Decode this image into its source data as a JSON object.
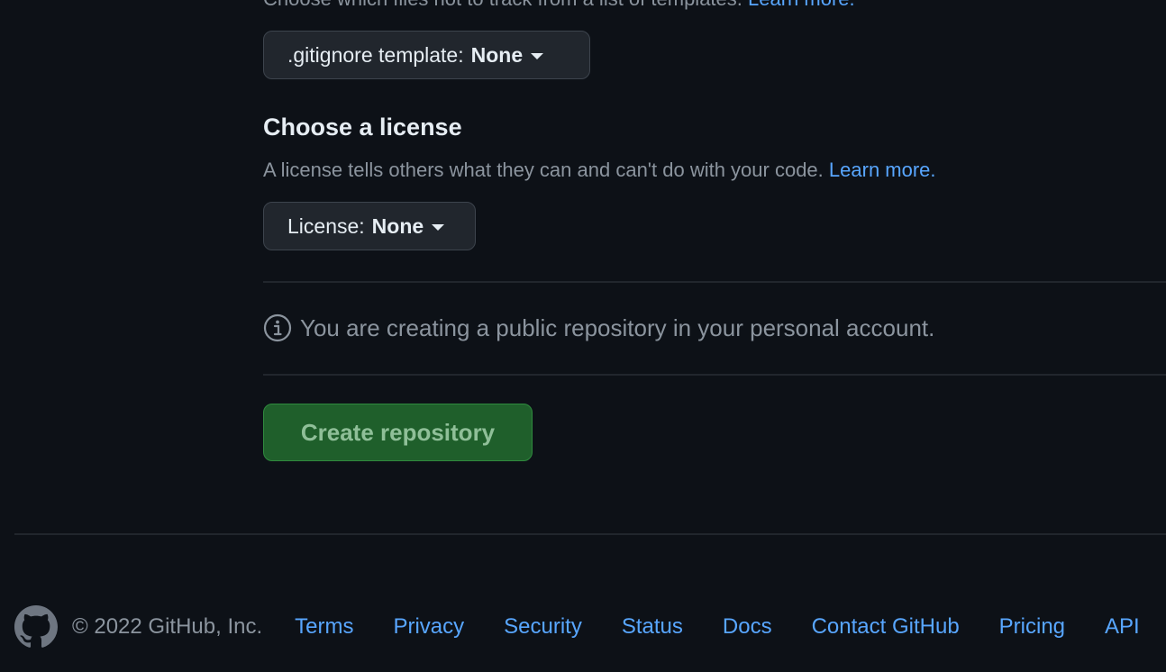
{
  "gitignore_section": {
    "description": "Choose which files not to track from a list of templates.",
    "learn_more": "Learn more.",
    "select_label": ".gitignore template:",
    "select_value": "None"
  },
  "license_section": {
    "heading": "Choose a license",
    "description": "A license tells others what they can and can't do with your code.",
    "learn_more": "Learn more.",
    "select_label": "License:",
    "select_value": "None"
  },
  "notice": {
    "text": "You are creating a public repository in your personal account."
  },
  "create_button": {
    "label": "Create repository"
  },
  "footer": {
    "copyright": "© 2022 GitHub, Inc.",
    "links": [
      "Terms",
      "Privacy",
      "Security",
      "Status",
      "Docs",
      "Contact GitHub",
      "Pricing",
      "API"
    ]
  },
  "colors": {
    "background": "#0d1117",
    "link": "#58a6ff",
    "button_green": "#1f5f2b"
  }
}
